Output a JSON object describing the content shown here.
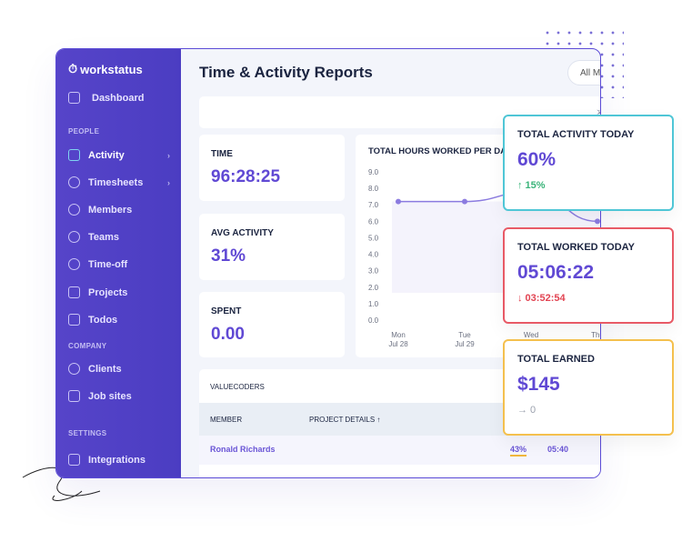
{
  "app": {
    "logo": "workstatus"
  },
  "sidebar": {
    "dashboard": "Dashboard",
    "sections": [
      "PEOPLE",
      "COMPANY",
      "SETTINGS"
    ],
    "items": [
      {
        "label": "Activity",
        "icon": "chart-line-icon",
        "chevron": "›"
      },
      {
        "label": "Timesheets",
        "icon": "pie-chart-icon",
        "chevron": "›"
      },
      {
        "label": "Members",
        "icon": "user-icon"
      },
      {
        "label": "Teams",
        "icon": "teams-icon"
      },
      {
        "label": "Time-off",
        "icon": "timer-icon"
      },
      {
        "label": "Projects",
        "icon": "folder-icon"
      },
      {
        "label": "Todos",
        "icon": "checklist-icon"
      },
      {
        "label": "Clients",
        "icon": "clients-icon"
      },
      {
        "label": "Job sites",
        "icon": "building-icon"
      },
      {
        "label": "Integrations",
        "icon": "puzzle-icon"
      }
    ]
  },
  "header": {
    "title": "Time & Activity Reports",
    "filter": "All Me"
  },
  "stats": [
    {
      "label": "TIME",
      "value": "96:28:25"
    },
    {
      "label": "AVG ACTIVITY",
      "value": "31%"
    },
    {
      "label": "SPENT",
      "value": "0.00"
    }
  ],
  "table": {
    "org": "VALUECODERS",
    "columns": [
      "MEMBER",
      "PROJECT DETAILS ↑"
    ],
    "rows": [
      {
        "member": "Ronald Richards",
        "activity": "43%",
        "time": "05:40"
      }
    ]
  },
  "floating": {
    "activity": {
      "label": "TOTAL ACTIVITY TODAY",
      "value": "60%",
      "delta": "↑ 15%",
      "color": "#4fc6d6"
    },
    "worked": {
      "label": "TOTAL WORKED TODAY",
      "value": "05:06:22",
      "delta": "↓ 03:52:54",
      "color": "#e85a66"
    },
    "earned": {
      "label": "TOTAL EARNED",
      "value": "$145",
      "delta": "→ 0",
      "color": "#f4c04e"
    }
  },
  "chart_data": {
    "type": "line",
    "title": "TOTAL HOURS WORKED PER DAY",
    "categories": [
      [
        "Mon",
        "Jul 28"
      ],
      [
        "Tue",
        "Jul 29"
      ],
      [
        "Wed",
        ""
      ],
      [
        "Thu",
        ""
      ]
    ],
    "values": [
      7.2,
      7.2,
      7.8,
      6.0
    ],
    "yticks": [
      "0.0",
      "1.0",
      "2.0",
      "3.0",
      "4.0",
      "5.0",
      "6.0",
      "7.0",
      "8.0",
      "9.0"
    ],
    "ylim": [
      0,
      9
    ],
    "color": "#8b7be0"
  }
}
